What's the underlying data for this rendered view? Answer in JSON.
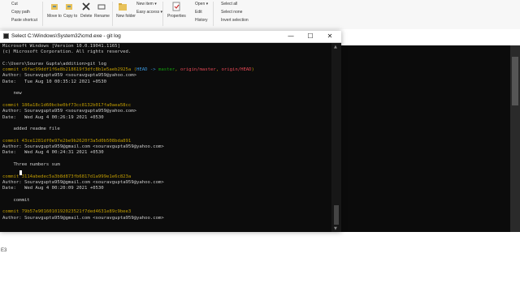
{
  "ribbon": {
    "cut": "Cut",
    "copy_path": "Copy path",
    "paste_shortcut": "Paste shortcut",
    "move_to": "Move to",
    "copy_to": "Copy to",
    "delete": "Delete",
    "rename": "Rename",
    "new_folder": "New folder",
    "new_item": "New item ▾",
    "easy_access": "Easy access ▾",
    "properties": "Properties",
    "open": "Open ▾",
    "edit": "Edit",
    "history": "History",
    "select_all": "Select all",
    "select_none": "Select none",
    "invert_selection": "Invert selection"
  },
  "background": {
    "stray_text": "E3"
  },
  "window": {
    "title": "Select C:\\Windows\\System32\\cmd.exe - git  log",
    "minimize": "—",
    "maximize": "☐",
    "close": "✕"
  },
  "terminal": {
    "banner1": "Microsoft Windows [Version 10.0.19041.1165]",
    "banner2": "(c) Microsoft Corporation. All rights reserved.",
    "prompt": "C:\\Users\\Sourav Gupta\\addition>git log",
    "commit_word": "commit ",
    "author_label": "Author: ",
    "date_label": "Date:   ",
    "head_open": " (",
    "head_label": "HEAD -> ",
    "head_sep": ", ",
    "head_close": ")",
    "branch_master": "master",
    "branch_origin_master": "origin/master",
    "branch_origin_head": "origin/HEAD",
    "commits": [
      {
        "hash": "c6fac99ddf1f6e8b218619f3dfc8b1e5aeb2925a",
        "author": "Souravgupta959 <souravgupta959@yahoo.com>",
        "date": "Tue Aug 10 00:35:12 2021 +0530",
        "message": "    new"
      },
      {
        "hash": "186a18c1d60bcbe0bf73cc8132b017fa0aea58cc",
        "author": "Souravgupta959 <souravgupta959@yahoo.com>",
        "date": "Wed Aug 4 00:26:19 2021 +0530",
        "message": "    added readme file"
      },
      {
        "hash": "43ce1281df0e97e2be9b2620f3a5d0b508bda891",
        "author": "Souravgupta959@gmail.com <souravgupta959@yahoo.com>",
        "date": "Wed Aug 4 00:24:31 2021 +0530",
        "message": "    Three numbers sum"
      },
      {
        "hash": "3114abedec5a3b8d873fb6817d1a999e1e6c823a",
        "author": "Souravgupta959@gmail.com <souravgupta959@yahoo.com>",
        "date": "Wed Aug 4 00:20:09 2021 +0530",
        "message": "    commit"
      },
      {
        "hash": "79b57e9016010192023521f7ded4631e89c9bee3",
        "author": "Souravgupta959@gmail.com <souravgupta959@yahoo.com>"
      }
    ]
  }
}
